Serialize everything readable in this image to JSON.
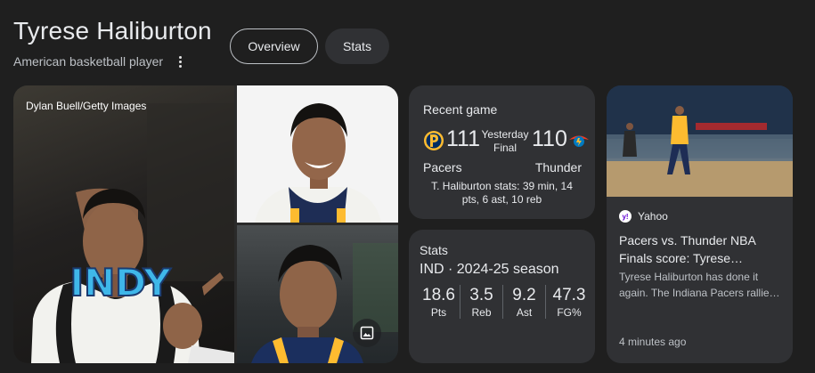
{
  "header": {
    "title": "Tyrese Haliburton",
    "subtitle": "American basketball player"
  },
  "tabs": [
    {
      "label": "Overview"
    },
    {
      "label": "Stats"
    }
  ],
  "photos": {
    "credit": "Dylan Buell/Getty Images",
    "jersey_text": "INDY"
  },
  "recent_game": {
    "label": "Recent game",
    "when": "Yesterday",
    "status": "Final",
    "home": {
      "name": "Pacers",
      "score": "111"
    },
    "away": {
      "name": "Thunder",
      "score": "110"
    },
    "player_line": "T. Haliburton stats: 39 min, 14 pts, 6 ast, 10 reb"
  },
  "stats": {
    "label": "Stats",
    "season": "IND · 2024-25 season",
    "items": [
      {
        "value": "18.6",
        "label": "Pts"
      },
      {
        "value": "3.5",
        "label": "Reb"
      },
      {
        "value": "9.2",
        "label": "Ast"
      },
      {
        "value": "47.3",
        "label": "FG%"
      }
    ]
  },
  "news": {
    "source": "Yahoo",
    "headline": "Pacers vs. Thunder NBA Finals score: Tyrese…",
    "snippet": "Tyrese Haliburton has done it again. The Indiana Pacers rallie…",
    "time": "4 minutes ago"
  },
  "colors": {
    "background": "#1f1f1f",
    "card": "#303134",
    "pacers_navy": "#002d62",
    "pacers_gold": "#fdbb30",
    "thunder_blue": "#007ac1",
    "thunder_orange": "#ef3b24"
  },
  "icons": [
    "more-vert-icon",
    "gallery-icon",
    "pacers-logo",
    "thunder-logo",
    "yahoo-icon"
  ]
}
